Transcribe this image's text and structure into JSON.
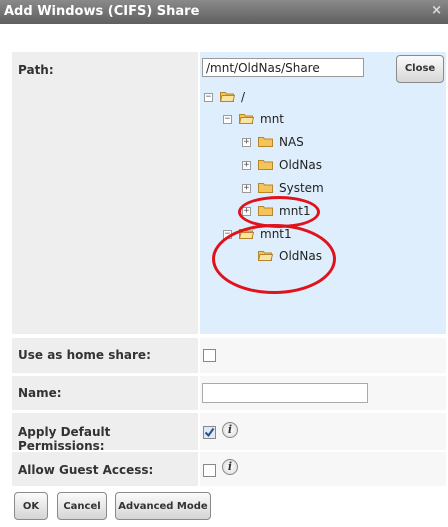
{
  "window": {
    "title": "Add Windows (CIFS) Share",
    "close_glyph": "×"
  },
  "form": {
    "path": {
      "label": "Path:",
      "value": "/mnt/OldNas/Share",
      "close_button": "Close",
      "tree": {
        "root": "/",
        "mnt": "mnt",
        "nas": "NAS",
        "oldnas": "OldNas",
        "system": "System",
        "mnt1": "mnt1",
        "mnt1_top": "mnt1",
        "oldnas_child": "OldNas"
      }
    },
    "home_share": {
      "label": "Use as home share:",
      "checked": false
    },
    "name": {
      "label": "Name:",
      "value": ""
    },
    "default_perms": {
      "label": "Apply Default Permissions:",
      "checked": true,
      "info_glyph": "i"
    },
    "guest": {
      "label": "Allow Guest Access:",
      "checked": false,
      "info_glyph": "i"
    }
  },
  "buttons": {
    "ok": "OK",
    "cancel": "Cancel",
    "advanced": "Advanced Mode"
  },
  "colors": {
    "tree_bg": "#dfeefc",
    "highlight_circle": "#e0121c",
    "folder": "#f4c35a"
  },
  "icons": {
    "folder": "folder-icon",
    "folder_open": "folder-open-icon",
    "info": "info-icon",
    "close": "close-icon"
  }
}
